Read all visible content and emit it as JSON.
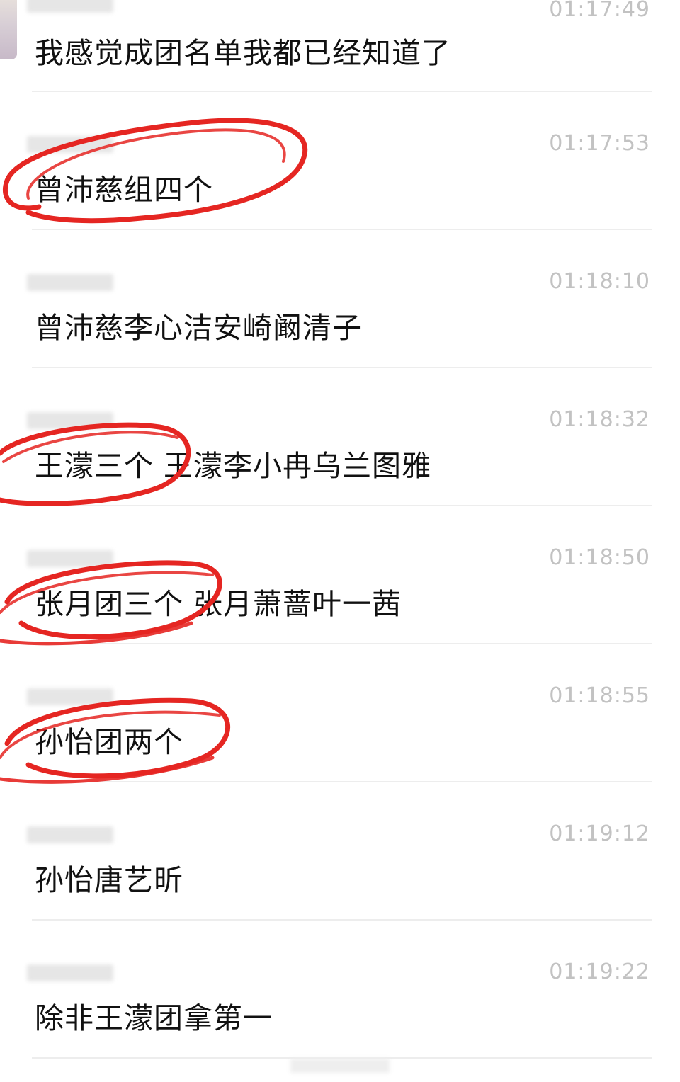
{
  "messages": [
    {
      "time": "01:17:49",
      "text": "我感觉成团名单我都已经知道了"
    },
    {
      "time": "01:17:53",
      "text": "曾沛慈组四个"
    },
    {
      "time": "01:18:10",
      "text": "曾沛慈李心洁安崎阚清子"
    },
    {
      "time": "01:18:32",
      "text": "王濛三个 王濛李小冉乌兰图雅"
    },
    {
      "time": "01:18:50",
      "text": "张月团三个 张月萧蔷叶一茜"
    },
    {
      "time": "01:18:55",
      "text": "孙怡团两个"
    },
    {
      "time": "01:19:12",
      "text": "孙怡唐艺昕"
    },
    {
      "time": "01:19:22",
      "text": "除非王濛团拿第一"
    }
  ],
  "icons": {
    "annotation": "red-circle-annotation-icon",
    "blur": "redacted-username-icon"
  },
  "colors": {
    "annotation_red": "#e52622",
    "time_gray": "#c2c2c2",
    "text_black": "#111111",
    "divider": "#ededed"
  }
}
